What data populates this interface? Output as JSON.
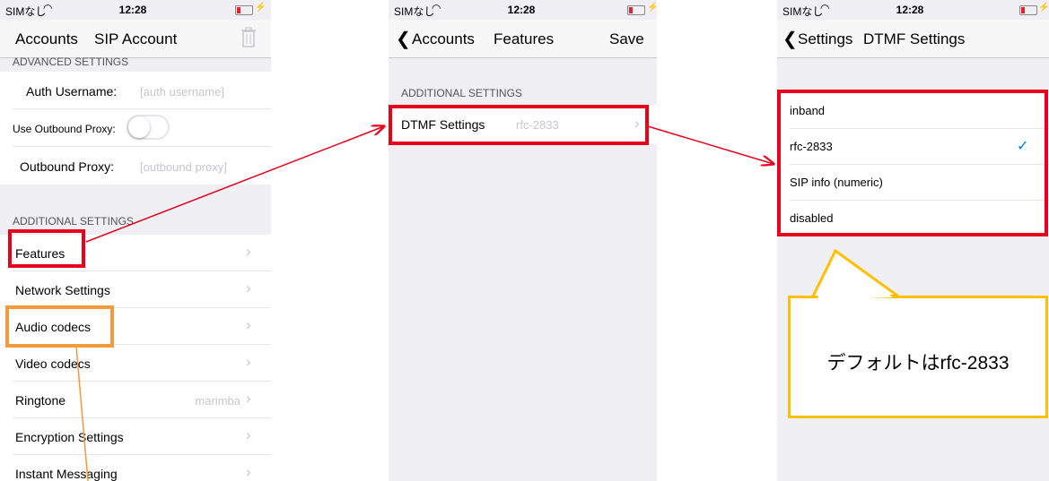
{
  "status": {
    "carrier": "SIMなし",
    "time": "12:28",
    "bolt": "⚡"
  },
  "screen1": {
    "nav": {
      "back": "Accounts",
      "title": "SIP Account"
    },
    "advanced_header": "ADVANCED SETTINGS",
    "auth_username": {
      "label": "Auth Username:",
      "placeholder": "[auth username]"
    },
    "outbound_proxy_toggle": {
      "label": "Use Outbound Proxy:",
      "on": false
    },
    "outbound_proxy": {
      "label": "Outbound Proxy:",
      "placeholder": "[outbound proxy]"
    },
    "additional_header": "ADDITIONAL SETTINGS",
    "items": [
      {
        "label": "Features",
        "detail": ""
      },
      {
        "label": "Network Settings",
        "detail": ""
      },
      {
        "label": "Audio codecs",
        "detail": ""
      },
      {
        "label": "Video codecs",
        "detail": ""
      },
      {
        "label": "Ringtone",
        "detail": "marimba"
      },
      {
        "label": "Encryption Settings",
        "detail": ""
      },
      {
        "label": "Instant Messaging",
        "detail": ""
      }
    ]
  },
  "screen2": {
    "nav": {
      "back": "Accounts",
      "title": "Features",
      "action": "Save"
    },
    "additional_header": "ADDITIONAL SETTINGS",
    "dtmf_row": {
      "label": "DTMF Settings",
      "detail": "rfc-2833"
    }
  },
  "screen3": {
    "nav": {
      "back": "Settings",
      "title": "DTMF Settings"
    },
    "options": [
      {
        "label": "inband",
        "selected": false
      },
      {
        "label": "rfc-2833",
        "selected": true
      },
      {
        "label": "SIP info (numeric)",
        "selected": false
      },
      {
        "label": "disabled",
        "selected": false
      }
    ]
  },
  "callout": {
    "text": "デフォルトはrfc-2833"
  },
  "colors": {
    "red": "#e8001c",
    "orange": "#f39a3a",
    "callout_border": "#ffc000",
    "ios_blue": "#007aff",
    "bg": "#efeff4"
  }
}
